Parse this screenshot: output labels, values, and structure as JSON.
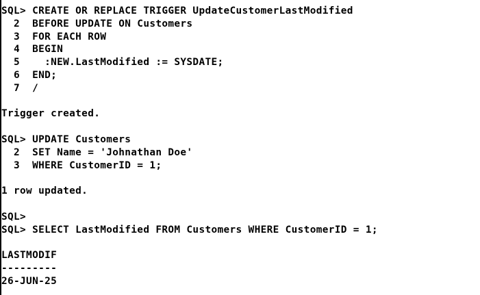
{
  "console": {
    "lines": [
      "SQL> CREATE OR REPLACE TRIGGER UpdateCustomerLastModified",
      "  2  BEFORE UPDATE ON Customers",
      "  3  FOR EACH ROW",
      "  4  BEGIN",
      "  5    :NEW.LastModified := SYSDATE;",
      "  6  END;",
      "  7  /",
      "",
      "Trigger created.",
      "",
      "SQL> UPDATE Customers",
      "  2  SET Name = 'Johnathan Doe'",
      "  3  WHERE CustomerID = 1;",
      "",
      "1 row updated.",
      "",
      "SQL>",
      "SQL> SELECT LastModified FROM Customers WHERE CustomerID = 1;",
      "",
      "LASTMODIF",
      "---------",
      "26-JUN-25"
    ]
  }
}
